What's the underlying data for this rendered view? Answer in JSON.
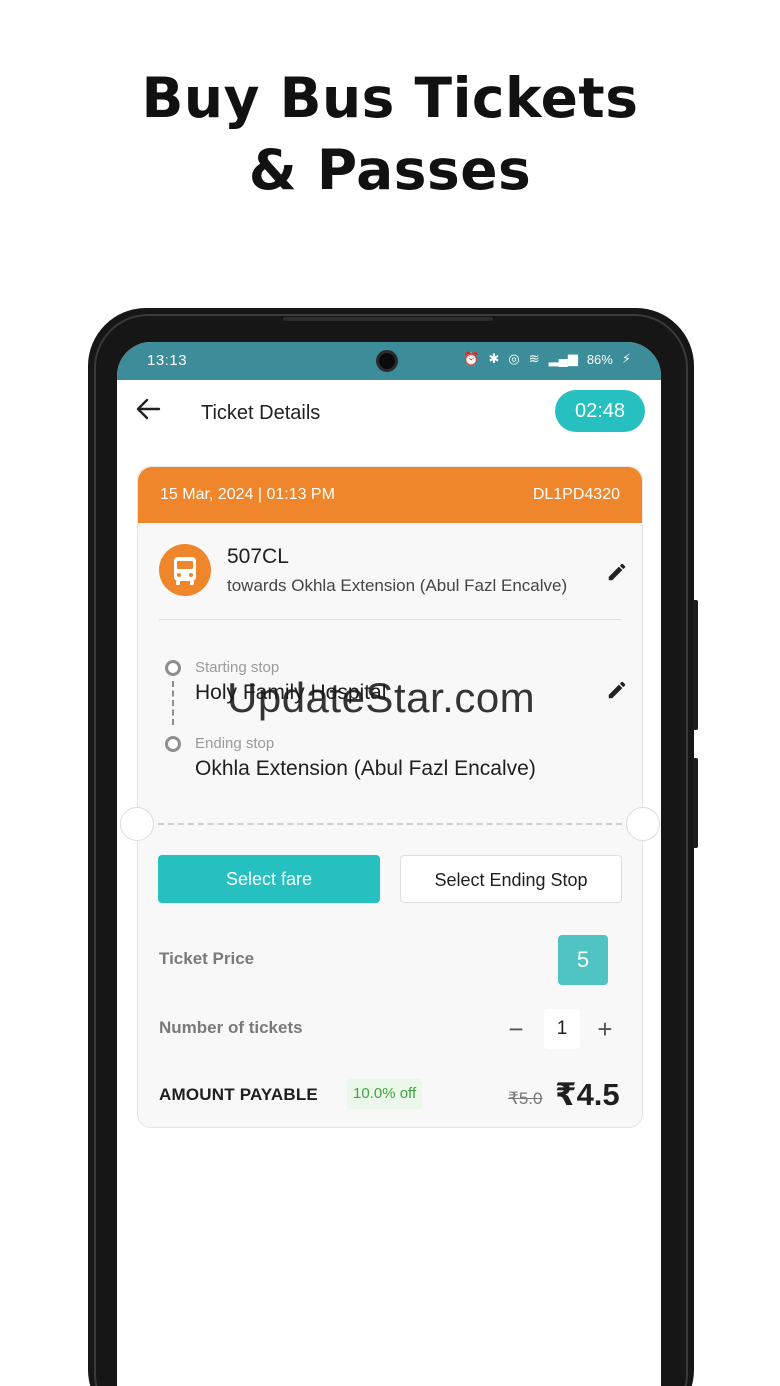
{
  "headline": {
    "line1": "Buy Bus Tickets",
    "line2": "& Passes"
  },
  "status_bar": {
    "time": "13:13",
    "battery": "86%"
  },
  "app_bar": {
    "title": "Ticket Details",
    "timer": "02:48"
  },
  "ticket": {
    "datetime": "15 Mar, 2024 | 01:13 PM",
    "vehicle_no": "DL1PD4320",
    "route_number": "507CL",
    "route_direction": "towards Okhla Extension (Abul Fazl Encalve)",
    "starting_stop_label": "Starting stop",
    "starting_stop": "Holy Family Hospital",
    "ending_stop_label": "Ending stop",
    "ending_stop": "Okhla Extension (Abul Fazl Encalve)"
  },
  "actions": {
    "select_fare": "Select fare",
    "select_ending_stop": "Select Ending Stop"
  },
  "pricing": {
    "ticket_price_label": "Ticket Price",
    "ticket_price": "5",
    "num_tickets_label": "Number of tickets",
    "quantity": "1",
    "minus": "−",
    "plus": "+",
    "amount_payable_label": "AMOUNT PAYABLE",
    "discount": "10.0% off",
    "original_price": "₹5.0",
    "final_price": "₹4.5"
  },
  "watermark": "UpdateStar.com",
  "colors": {
    "teal": "#26c0c0",
    "orange": "#f0862b",
    "status_bar": "#3d8c99"
  }
}
